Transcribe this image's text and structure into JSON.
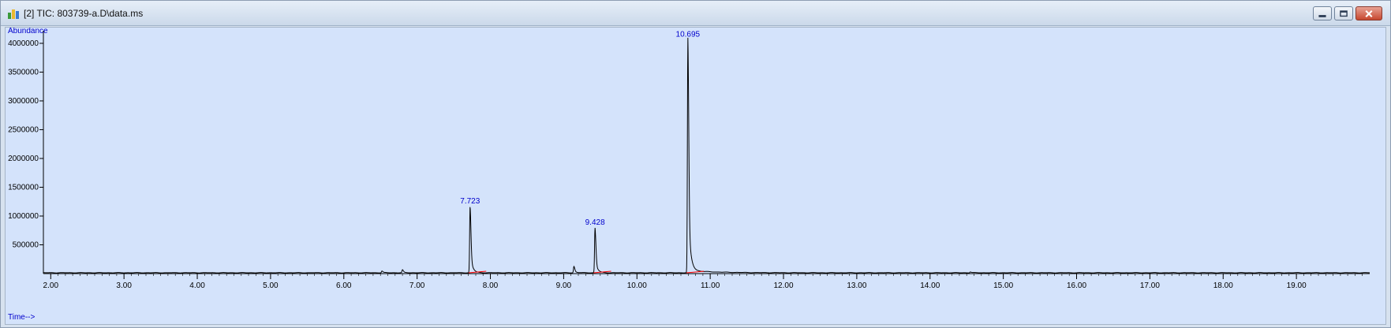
{
  "window": {
    "title": "[2] TIC: 803739-a.D\\data.ms",
    "controls": [
      "minimize",
      "restore",
      "close"
    ]
  },
  "chart_data": {
    "type": "line",
    "ylabel": "Abundance",
    "xlabel": "Time-->",
    "xlim": [
      1.9,
      20.0
    ],
    "ylim": [
      0,
      4150000
    ],
    "x_ticks": [
      "2.00",
      "3.00",
      "4.00",
      "5.00",
      "6.00",
      "7.00",
      "8.00",
      "9.00",
      "10.00",
      "11.00",
      "12.00",
      "13.00",
      "14.00",
      "15.00",
      "16.00",
      "17.00",
      "18.00",
      "19.00"
    ],
    "y_ticks": [
      "500000",
      "1000000",
      "1500000",
      "2000000",
      "2500000",
      "3000000",
      "3500000",
      "4000000"
    ],
    "grid": false,
    "colors": {
      "trace": "#000000",
      "baseline": "#ff0000",
      "peak_label": "#0000cc",
      "axis_label": "#0000cc"
    },
    "peaks": [
      {
        "rt": 7.723,
        "label": "7.723",
        "height": 1150000
      },
      {
        "rt": 9.428,
        "label": "9.428",
        "height": 780000
      },
      {
        "rt": 10.695,
        "label": "10.695",
        "height": 4050000
      }
    ],
    "minor_peaks": [
      {
        "rt": 6.52,
        "height": 30000
      },
      {
        "rt": 6.8,
        "height": 50000
      },
      {
        "rt": 9.14,
        "height": 110000
      },
      {
        "rt": 14.55,
        "height": 15000
      }
    ],
    "baseline_level": 15000
  }
}
